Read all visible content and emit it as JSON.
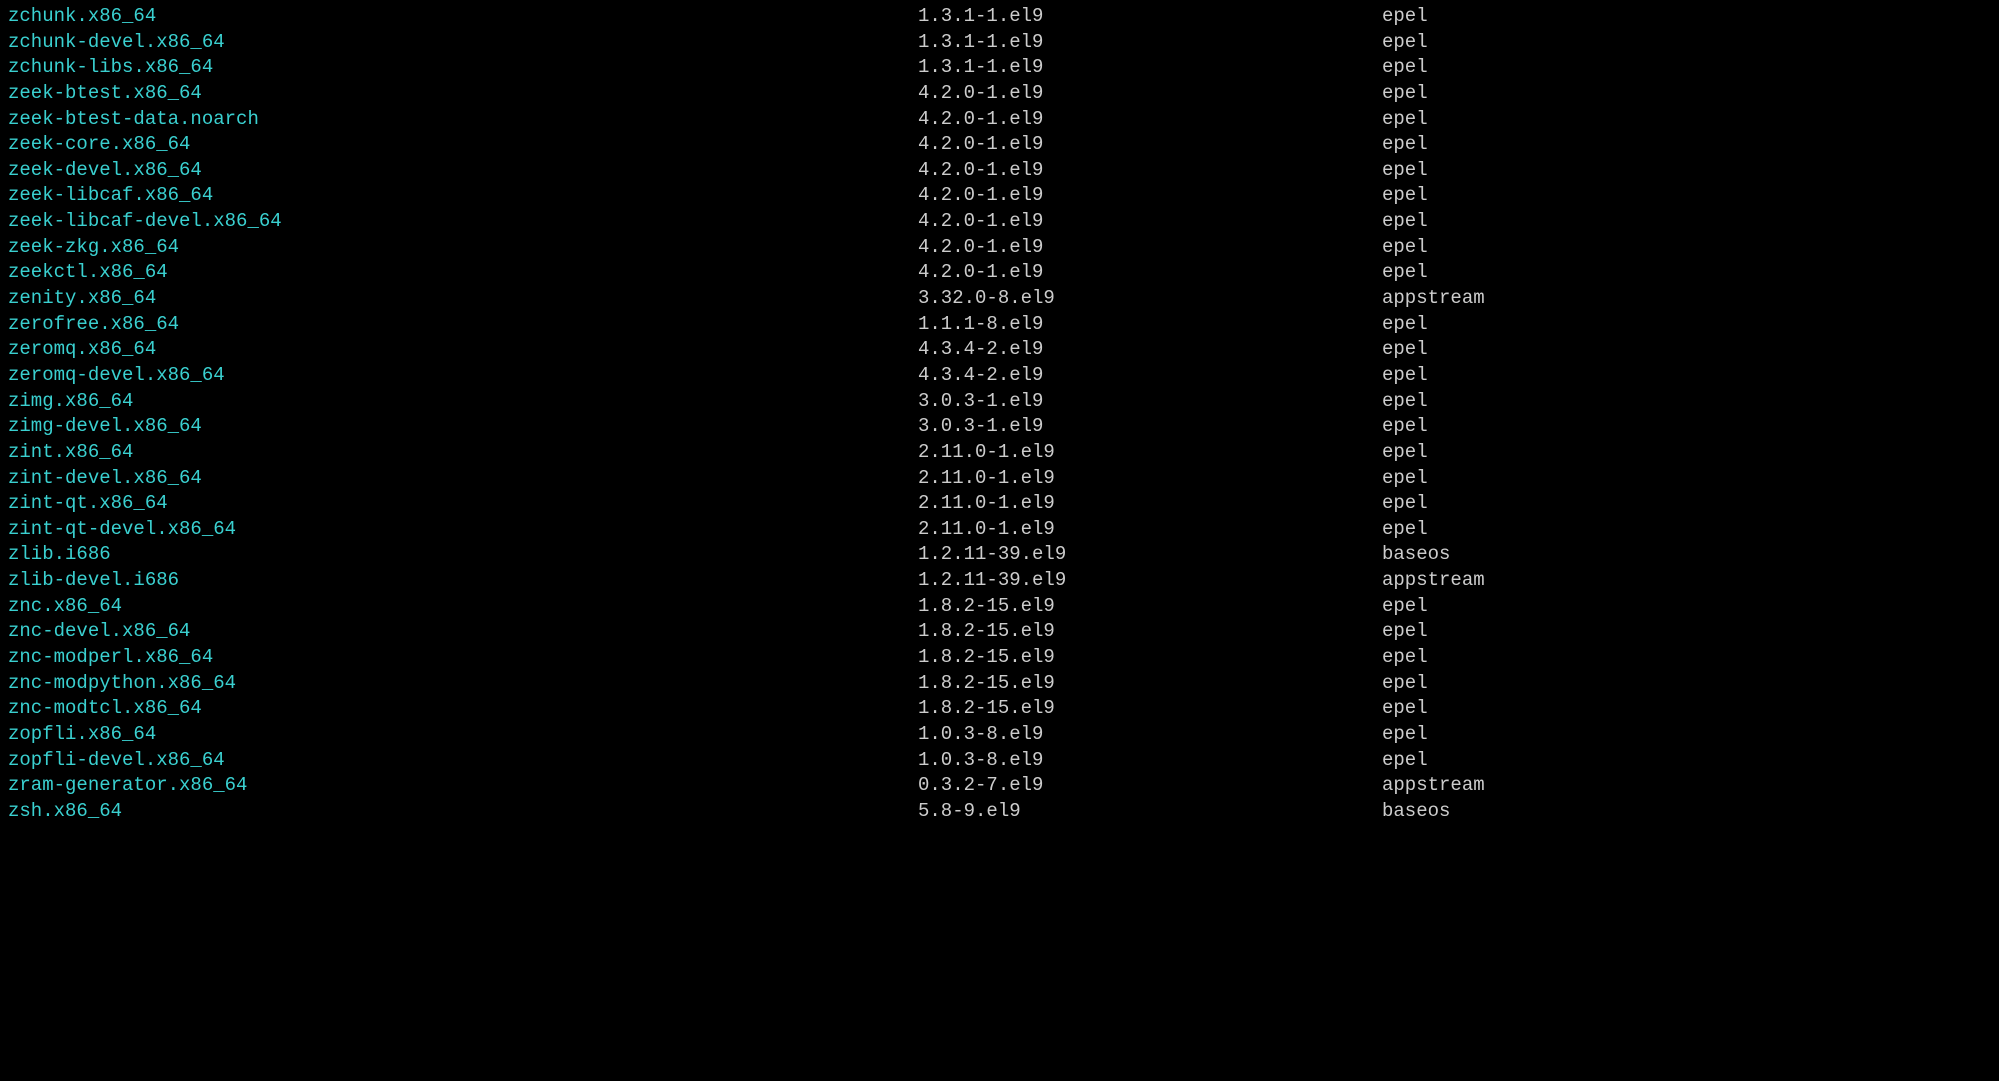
{
  "packages": [
    {
      "name": "zchunk.x86_64",
      "version": "1.3.1-1.el9",
      "repo": "epel"
    },
    {
      "name": "zchunk-devel.x86_64",
      "version": "1.3.1-1.el9",
      "repo": "epel"
    },
    {
      "name": "zchunk-libs.x86_64",
      "version": "1.3.1-1.el9",
      "repo": "epel"
    },
    {
      "name": "zeek-btest.x86_64",
      "version": "4.2.0-1.el9",
      "repo": "epel"
    },
    {
      "name": "zeek-btest-data.noarch",
      "version": "4.2.0-1.el9",
      "repo": "epel"
    },
    {
      "name": "zeek-core.x86_64",
      "version": "4.2.0-1.el9",
      "repo": "epel"
    },
    {
      "name": "zeek-devel.x86_64",
      "version": "4.2.0-1.el9",
      "repo": "epel"
    },
    {
      "name": "zeek-libcaf.x86_64",
      "version": "4.2.0-1.el9",
      "repo": "epel"
    },
    {
      "name": "zeek-libcaf-devel.x86_64",
      "version": "4.2.0-1.el9",
      "repo": "epel"
    },
    {
      "name": "zeek-zkg.x86_64",
      "version": "4.2.0-1.el9",
      "repo": "epel"
    },
    {
      "name": "zeekctl.x86_64",
      "version": "4.2.0-1.el9",
      "repo": "epel"
    },
    {
      "name": "zenity.x86_64",
      "version": "3.32.0-8.el9",
      "repo": "appstream"
    },
    {
      "name": "zerofree.x86_64",
      "version": "1.1.1-8.el9",
      "repo": "epel"
    },
    {
      "name": "zeromq.x86_64",
      "version": "4.3.4-2.el9",
      "repo": "epel"
    },
    {
      "name": "zeromq-devel.x86_64",
      "version": "4.3.4-2.el9",
      "repo": "epel"
    },
    {
      "name": "zimg.x86_64",
      "version": "3.0.3-1.el9",
      "repo": "epel"
    },
    {
      "name": "zimg-devel.x86_64",
      "version": "3.0.3-1.el9",
      "repo": "epel"
    },
    {
      "name": "zint.x86_64",
      "version": "2.11.0-1.el9",
      "repo": "epel"
    },
    {
      "name": "zint-devel.x86_64",
      "version": "2.11.0-1.el9",
      "repo": "epel"
    },
    {
      "name": "zint-qt.x86_64",
      "version": "2.11.0-1.el9",
      "repo": "epel"
    },
    {
      "name": "zint-qt-devel.x86_64",
      "version": "2.11.0-1.el9",
      "repo": "epel"
    },
    {
      "name": "zlib.i686",
      "version": "1.2.11-39.el9",
      "repo": "baseos"
    },
    {
      "name": "zlib-devel.i686",
      "version": "1.2.11-39.el9",
      "repo": "appstream"
    },
    {
      "name": "znc.x86_64",
      "version": "1.8.2-15.el9",
      "repo": "epel"
    },
    {
      "name": "znc-devel.x86_64",
      "version": "1.8.2-15.el9",
      "repo": "epel"
    },
    {
      "name": "znc-modperl.x86_64",
      "version": "1.8.2-15.el9",
      "repo": "epel"
    },
    {
      "name": "znc-modpython.x86_64",
      "version": "1.8.2-15.el9",
      "repo": "epel"
    },
    {
      "name": "znc-modtcl.x86_64",
      "version": "1.8.2-15.el9",
      "repo": "epel"
    },
    {
      "name": "zopfli.x86_64",
      "version": "1.0.3-8.el9",
      "repo": "epel"
    },
    {
      "name": "zopfli-devel.x86_64",
      "version": "1.0.3-8.el9",
      "repo": "epel"
    },
    {
      "name": "zram-generator.x86_64",
      "version": "0.3.2-7.el9",
      "repo": "appstream"
    },
    {
      "name": "zsh.x86_64",
      "version": "5.8-9.el9",
      "repo": "baseos"
    }
  ]
}
